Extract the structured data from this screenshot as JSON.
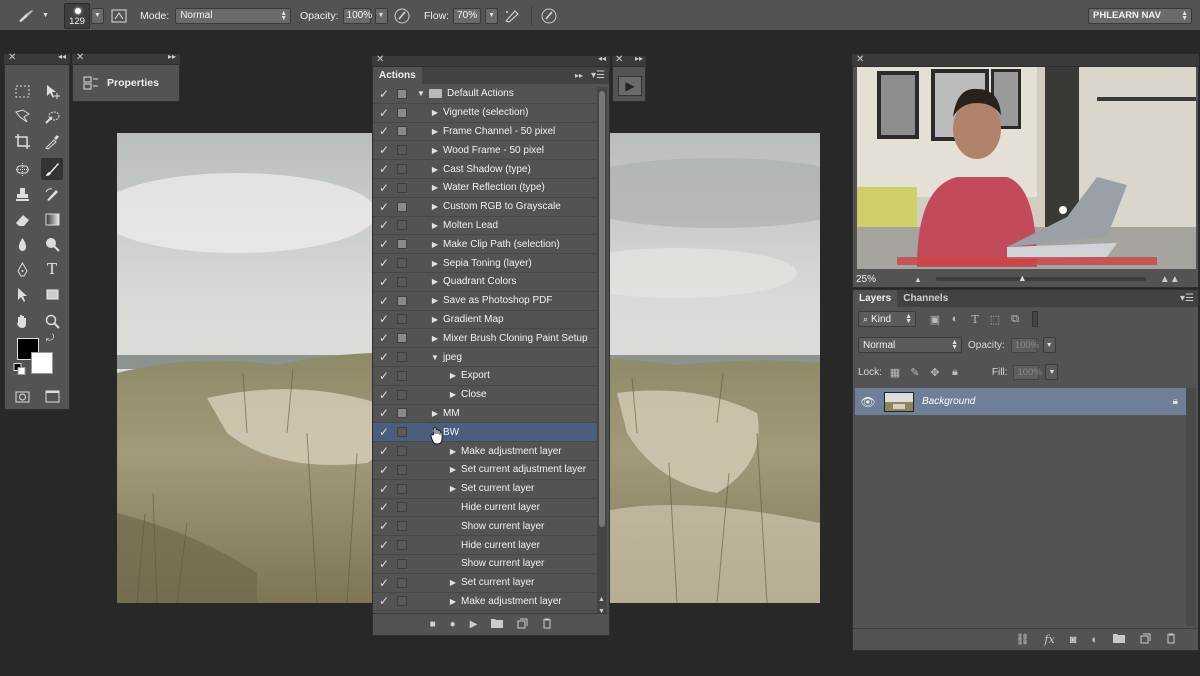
{
  "options_bar": {
    "brush_size": "129",
    "mode_label": "Mode:",
    "mode_value": "Normal",
    "opacity_label": "Opacity:",
    "opacity_value": "100%",
    "flow_label": "Flow:",
    "flow_value": "70%",
    "workspace": "PHLEARN NAV"
  },
  "properties": {
    "title": "Properties"
  },
  "actions": {
    "tab": "Actions",
    "items": [
      {
        "label": "Default Actions",
        "check": true,
        "dialog": true,
        "toggle": "down",
        "level": 0,
        "folder": true
      },
      {
        "label": "Vignette (selection)",
        "check": true,
        "dialog": true,
        "toggle": "right",
        "level": 1
      },
      {
        "label": "Frame Channel - 50 pixel",
        "check": true,
        "dialog": true,
        "toggle": "right",
        "level": 1
      },
      {
        "label": "Wood Frame - 50 pixel",
        "check": true,
        "dialog": false,
        "toggle": "right",
        "level": 1
      },
      {
        "label": "Cast Shadow (type)",
        "check": true,
        "dialog": false,
        "toggle": "right",
        "level": 1
      },
      {
        "label": "Water Reflection (type)",
        "check": true,
        "dialog": false,
        "toggle": "right",
        "level": 1
      },
      {
        "label": "Custom RGB to Grayscale",
        "check": true,
        "dialog": true,
        "toggle": "right",
        "level": 1
      },
      {
        "label": "Molten Lead",
        "check": true,
        "dialog": false,
        "toggle": "right",
        "level": 1
      },
      {
        "label": "Make Clip Path (selection)",
        "check": true,
        "dialog": true,
        "toggle": "right",
        "level": 1
      },
      {
        "label": "Sepia Toning (layer)",
        "check": true,
        "dialog": false,
        "toggle": "right",
        "level": 1
      },
      {
        "label": "Quadrant Colors",
        "check": true,
        "dialog": false,
        "toggle": "right",
        "level": 1
      },
      {
        "label": "Save as Photoshop PDF",
        "check": true,
        "dialog": true,
        "toggle": "right",
        "level": 1
      },
      {
        "label": "Gradient Map",
        "check": true,
        "dialog": false,
        "toggle": "right",
        "level": 1
      },
      {
        "label": "Mixer Brush Cloning Paint Setup",
        "check": true,
        "dialog": true,
        "toggle": "right",
        "level": 1
      },
      {
        "label": "jpeg",
        "check": true,
        "dialog": false,
        "toggle": "down",
        "level": 1
      },
      {
        "label": "Export",
        "check": true,
        "dialog": false,
        "toggle": "right",
        "level": 2
      },
      {
        "label": "Close",
        "check": true,
        "dialog": false,
        "toggle": "right",
        "level": 2
      },
      {
        "label": "MM",
        "check": true,
        "dialog": true,
        "toggle": "right",
        "level": 1
      },
      {
        "label": "BW",
        "check": true,
        "dialog": false,
        "toggle": "down",
        "level": 1,
        "selected": true
      },
      {
        "label": "Make adjustment layer",
        "check": true,
        "dialog": false,
        "toggle": "right",
        "level": 2
      },
      {
        "label": "Set current adjustment layer",
        "check": true,
        "dialog": false,
        "toggle": "right",
        "level": 2
      },
      {
        "label": "Set current layer",
        "check": true,
        "dialog": false,
        "toggle": "right",
        "level": 2
      },
      {
        "label": "Hide current layer",
        "check": true,
        "dialog": false,
        "toggle": "none",
        "level": 2
      },
      {
        "label": "Show current layer",
        "check": true,
        "dialog": false,
        "toggle": "none",
        "level": 2
      },
      {
        "label": "Hide current layer",
        "check": true,
        "dialog": false,
        "toggle": "none",
        "level": 2
      },
      {
        "label": "Show current layer",
        "check": true,
        "dialog": false,
        "toggle": "none",
        "level": 2
      },
      {
        "label": "Set current layer",
        "check": true,
        "dialog": false,
        "toggle": "right",
        "level": 2
      },
      {
        "label": "Make adjustment layer",
        "check": true,
        "dialog": false,
        "toggle": "right",
        "level": 2
      }
    ]
  },
  "navigator": {
    "zoom": "25%"
  },
  "layers": {
    "tabs": [
      "Layers",
      "Channels"
    ],
    "kind_filter": "Kind",
    "blend_mode": "Normal",
    "opacity_label": "Opacity:",
    "opacity_value": "100%",
    "lock_label": "Lock:",
    "fill_label": "Fill:",
    "fill_value": "100%",
    "layer_name": "Background"
  }
}
